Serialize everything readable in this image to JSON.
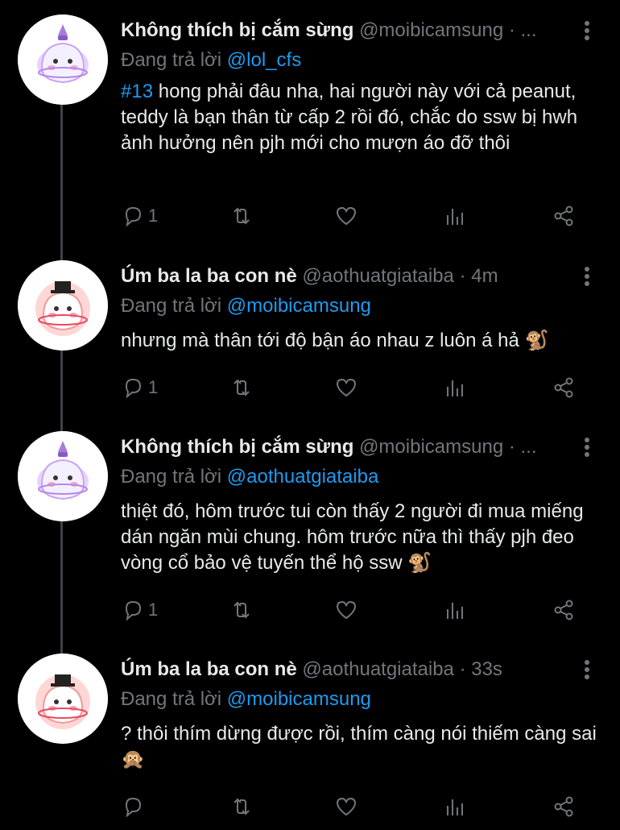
{
  "tweets": [
    {
      "display_name": "Không thích bị cắm sừng",
      "meta": "@moibicamsung · ...",
      "replying_prefix": "Đang trả lời",
      "replying_to": "@lol_cfs",
      "hashtag": "#13",
      "text": " hong phải đâu nha, hai người này với cả peanut, teddy là bạn thân từ cấp 2 rồi đó, chắc do ssw bị hwh ảnh hưởng nên pjh mới cho mượn áo đỡ thôi",
      "reply_count": "1",
      "avatar_icon": "unicorn-ghost-avatar"
    },
    {
      "display_name": "Úm ba la ba con nè",
      "meta": "@aothuatgiataiba · 4m",
      "replying_prefix": "Đang trả lời",
      "replying_to": "@moibicamsung",
      "hashtag": "",
      "text": "nhưng mà thân tới độ bận áo nhau z luôn á hả 🐒",
      "reply_count": "1",
      "avatar_icon": "magician-ghost-avatar"
    },
    {
      "display_name": "Không thích bị cắm sừng",
      "meta": "@moibicamsung · ...",
      "replying_prefix": "Đang trả lời",
      "replying_to": "@aothuatgiataiba",
      "hashtag": "",
      "text": "thiệt đó, hôm trước tui còn thấy 2 người đi mua miếng dán ngăn mùi chung. hôm trước nữa thì thấy pjh đeo vòng cổ bảo vệ tuyến thể hộ ssw 🐒",
      "reply_count": "1",
      "avatar_icon": "unicorn-ghost-avatar"
    },
    {
      "display_name": "Úm ba la ba con nè",
      "meta": "@aothuatgiataiba · 33s",
      "replying_prefix": "Đang trả lời",
      "replying_to": "@moibicamsung",
      "hashtag": "",
      "text": "? thôi thím dừng được rồi, thím càng nói thiếm càng sai 🙊",
      "reply_count": "",
      "avatar_icon": "magician-ghost-avatar"
    }
  ],
  "colors": {
    "background": "#000000",
    "text": "#e7e9ea",
    "muted": "#71767b",
    "link": "#1d9bf0",
    "thread_line": "#3f4346"
  }
}
